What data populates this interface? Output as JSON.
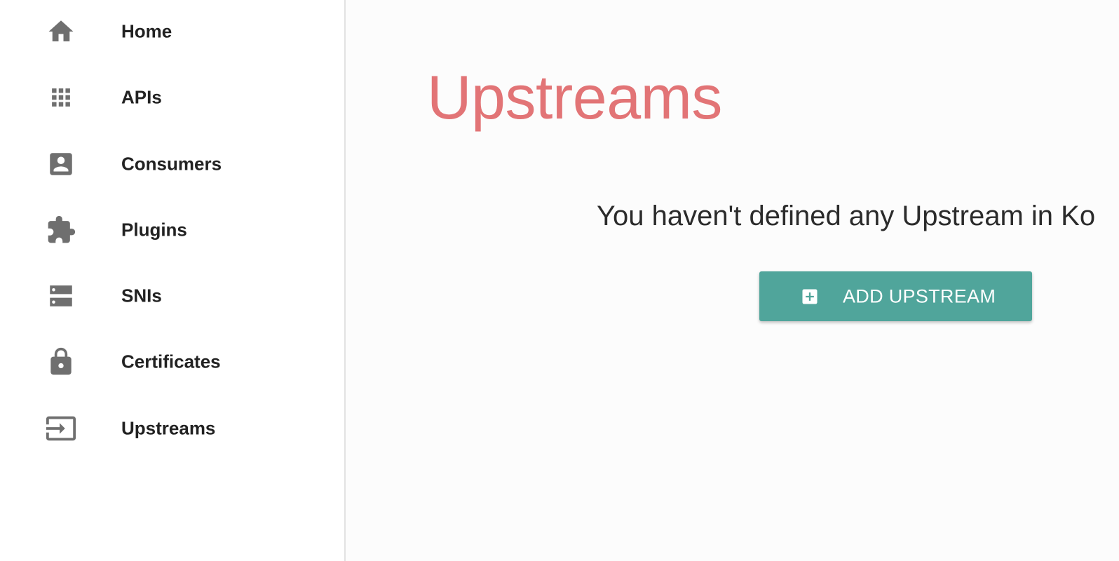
{
  "sidebar": {
    "items": [
      {
        "label": "Home",
        "icon": "home-icon"
      },
      {
        "label": "APIs",
        "icon": "apps-grid-icon"
      },
      {
        "label": "Consumers",
        "icon": "account-box-icon"
      },
      {
        "label": "Plugins",
        "icon": "puzzle-extension-icon"
      },
      {
        "label": "SNIs",
        "icon": "server-storage-icon"
      },
      {
        "label": "Certificates",
        "icon": "lock-icon"
      },
      {
        "label": "Upstreams",
        "icon": "input-arrow-icon"
      }
    ]
  },
  "main": {
    "title": "Upstreams",
    "empty_message": "You haven't defined any Upstream in Ko",
    "add_button_label": "ADD UPSTREAM",
    "add_button_icon": "add-box-icon"
  },
  "colors": {
    "title": "#e27476",
    "accent_button": "#50a59b",
    "icon_gray": "#6f6f6f",
    "sidebar_bg": "#ffffff",
    "main_bg": "#fcfcfc"
  }
}
